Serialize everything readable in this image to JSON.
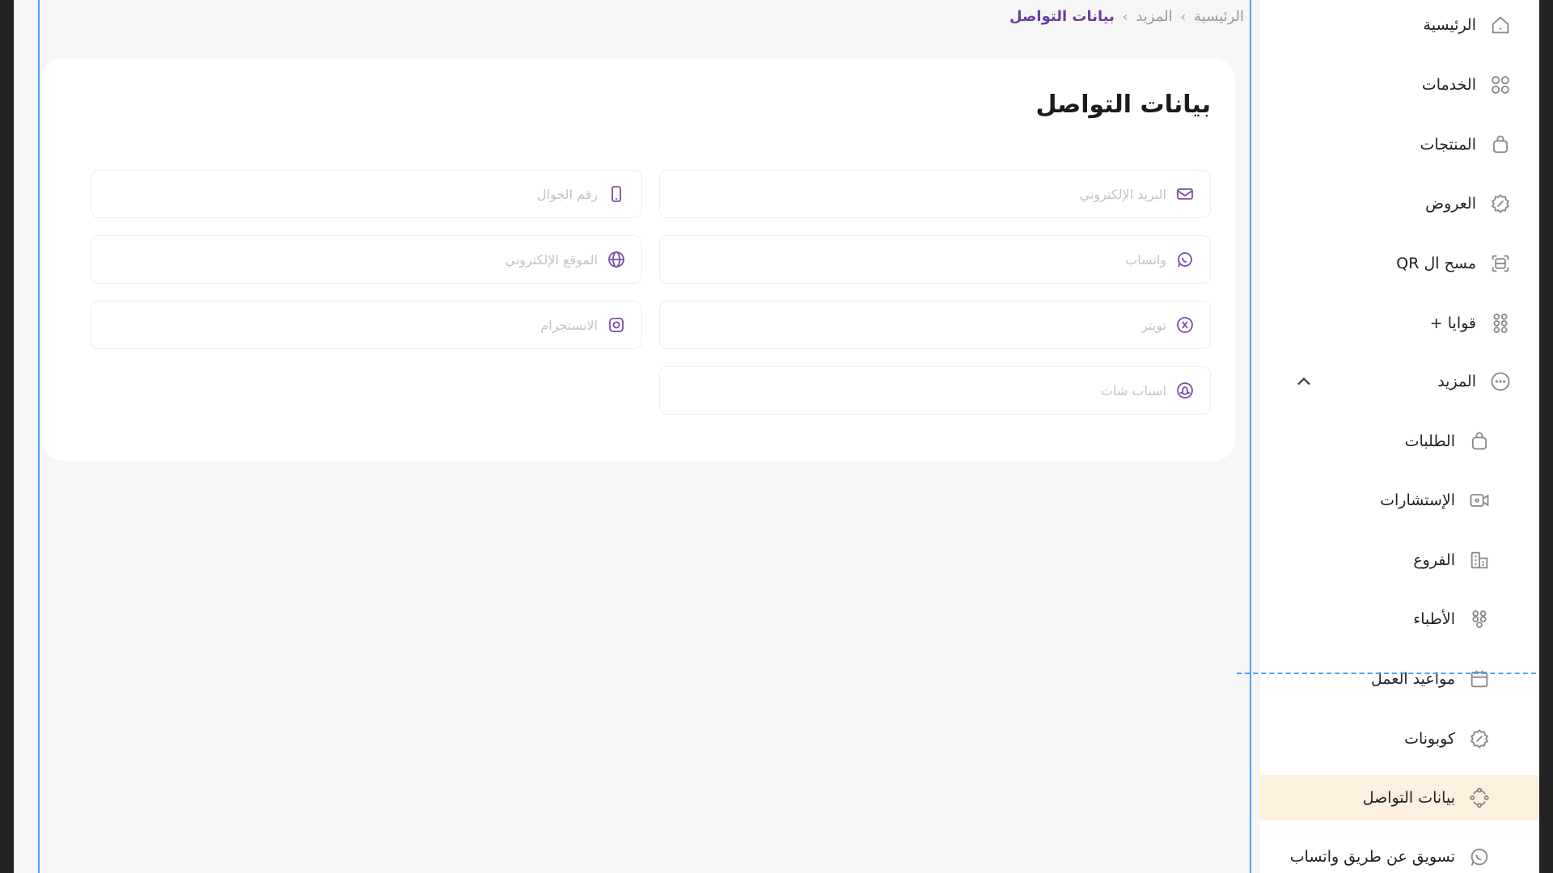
{
  "breadcrumb": {
    "items": [
      "الرئيسية",
      "المزيد",
      "بيانات التواصل"
    ],
    "separator": "›"
  },
  "page": {
    "title": "بيانات التواصل"
  },
  "form": {
    "email": {
      "placeholder": "البريد الإلكتروني",
      "icon": "mail-icon"
    },
    "phone": {
      "placeholder": "رقم الجوال",
      "icon": "mobile-icon"
    },
    "whatsapp": {
      "placeholder": "واتساب",
      "icon": "whatsapp-icon"
    },
    "website": {
      "placeholder": "الموقع الإلكتروني",
      "icon": "globe-icon"
    },
    "twitter": {
      "placeholder": "تويتر",
      "icon": "x-icon"
    },
    "instagram": {
      "placeholder": "الانستجرام",
      "icon": "instagram-icon"
    },
    "snapchat": {
      "placeholder": "اسناب شات",
      "icon": "snapchat-icon"
    }
  },
  "sidebar": {
    "items": [
      {
        "label": "الرئيسية",
        "icon": "home-icon"
      },
      {
        "label": "الخدمات",
        "icon": "grid-icon"
      },
      {
        "label": "المنتجات",
        "icon": "bag-icon"
      },
      {
        "label": "العروض",
        "icon": "discount-icon"
      },
      {
        "label": "مسح ال QR",
        "icon": "qr-scan-icon"
      },
      {
        "label": "قوايا +",
        "icon": "apps-icon"
      },
      {
        "label": "المزيد",
        "icon": "more-icon",
        "expanded": true
      },
      {
        "label": "الطلبات",
        "icon": "bag-icon"
      },
      {
        "label": "الإستشارات",
        "icon": "video-icon"
      },
      {
        "label": "الفروع",
        "icon": "building-icon"
      },
      {
        "label": "الأطباء",
        "icon": "people-icon"
      },
      {
        "label": "مواعيد العمل",
        "icon": "calendar-icon"
      },
      {
        "label": "كوبونات",
        "icon": "coupon-icon"
      },
      {
        "label": "بيانات التواصل",
        "icon": "contact-icon",
        "active": true
      },
      {
        "label": "تسويق عن طريق واتساب",
        "icon": "whatsapp-icon"
      }
    ]
  },
  "colors": {
    "accent": "#6b3fa0",
    "active_bg": "#fdf0df",
    "selection": "#4aa3ff"
  }
}
